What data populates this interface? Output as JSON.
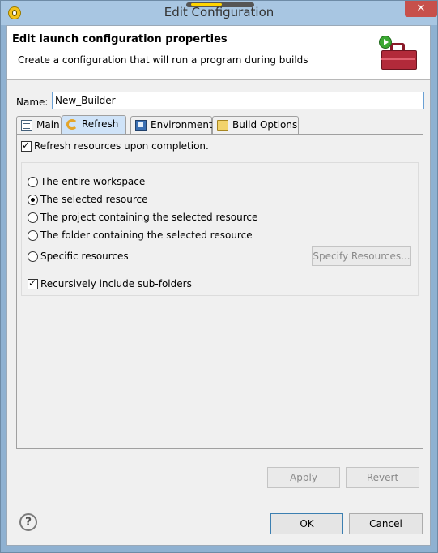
{
  "window": {
    "title": "Edit Configuration",
    "close_glyph": "✕"
  },
  "banner": {
    "title": "Edit launch configuration properties",
    "message": "Create a configuration that will run a program during builds"
  },
  "name_field": {
    "label": "Name:",
    "value": "New_Builder"
  },
  "tabs": [
    {
      "label": "Main",
      "icon": "main-tab-icon",
      "selected": false
    },
    {
      "label": "Refresh",
      "icon": "refresh-icon",
      "selected": true
    },
    {
      "label": "Environment",
      "icon": "environment-icon",
      "selected": false
    },
    {
      "label": "Build Options",
      "icon": "build-options-icon",
      "selected": false
    }
  ],
  "refresh_tab": {
    "refresh_on_completion": {
      "label": "Refresh resources upon completion.",
      "checked": true
    },
    "scope_options": [
      {
        "label": "The entire workspace",
        "selected": false
      },
      {
        "label": "The selected resource",
        "selected": true
      },
      {
        "label": "The project containing the selected resource",
        "selected": false
      },
      {
        "label": "The folder containing the selected resource",
        "selected": false
      },
      {
        "label": "Specific resources",
        "selected": false
      }
    ],
    "specify_resources_button": "Specify Resources...",
    "recursive": {
      "label": "Recursively include sub-folders",
      "checked": true
    }
  },
  "buttons": {
    "apply": "Apply",
    "revert": "Revert",
    "ok": "OK",
    "cancel": "Cancel",
    "help_glyph": "?"
  },
  "colors": {
    "title_bar": "#a8c6e2",
    "close_button": "#c7504b",
    "active_tab": "#cfe3f8",
    "input_border": "#6aa0d4"
  }
}
